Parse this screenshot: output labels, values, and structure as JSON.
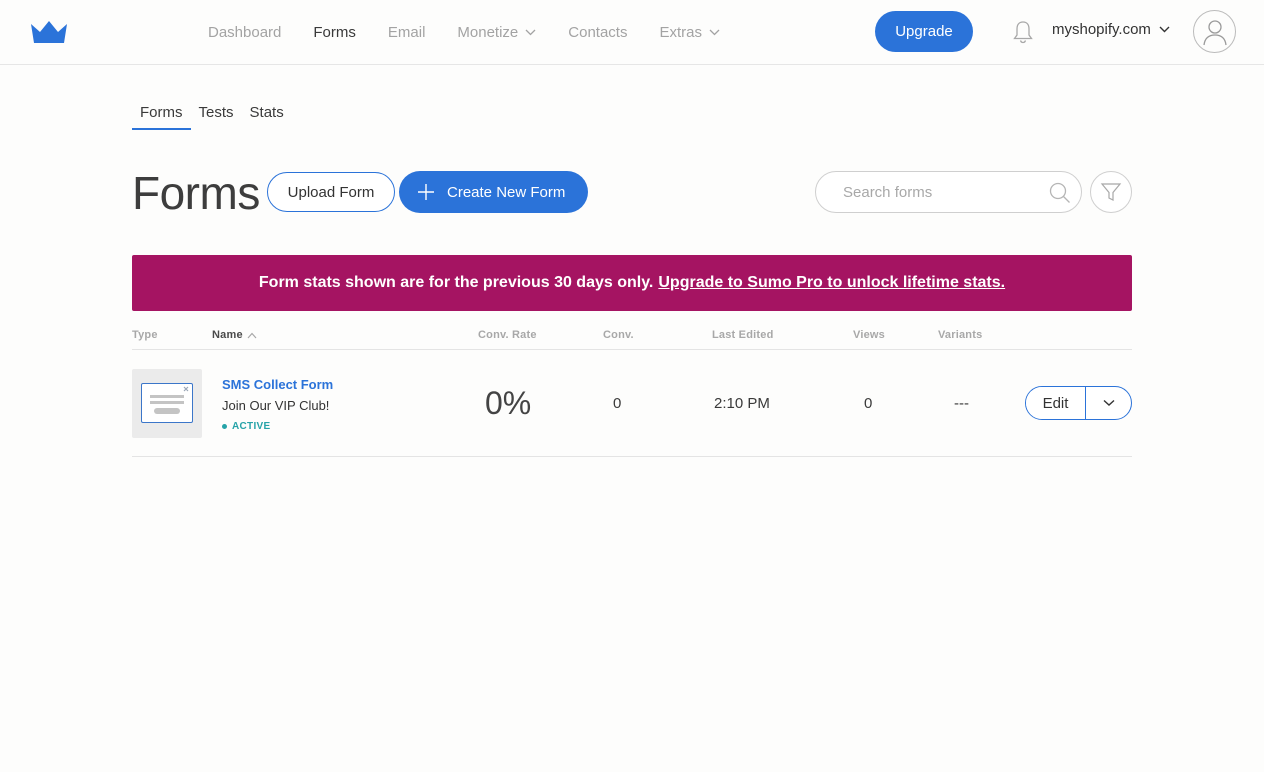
{
  "nav": {
    "items": [
      {
        "label": "Dashboard",
        "active": false,
        "dropdown": false
      },
      {
        "label": "Forms",
        "active": true,
        "dropdown": false
      },
      {
        "label": "Email",
        "active": false,
        "dropdown": false
      },
      {
        "label": "Monetize",
        "active": false,
        "dropdown": true
      },
      {
        "label": "Contacts",
        "active": false,
        "dropdown": false
      },
      {
        "label": "Extras",
        "active": false,
        "dropdown": true
      }
    ],
    "upgrade_label": "Upgrade",
    "site_label": "myshopify.com"
  },
  "subtabs": [
    {
      "label": "Forms",
      "active": true
    },
    {
      "label": "Tests",
      "active": false
    },
    {
      "label": "Stats",
      "active": false
    }
  ],
  "page": {
    "title": "Forms",
    "upload_label": "Upload Form",
    "create_label": "Create New Form",
    "search_placeholder": "Search forms"
  },
  "banner": {
    "text": "Form stats shown are for the previous 30 days only.",
    "link": "Upgrade to Sumo Pro to unlock lifetime stats."
  },
  "table": {
    "headers": {
      "type": "Type",
      "name": "Name",
      "conv_rate": "Conv. Rate",
      "conv": "Conv.",
      "last_edited": "Last Edited",
      "views": "Views",
      "variants": "Variants"
    },
    "rows": [
      {
        "name": "SMS Collect Form",
        "subtitle": "Join Our VIP Club!",
        "status": "ACTIVE",
        "conv_rate": "0%",
        "conv": "0",
        "last_edited": "2:10 PM",
        "views": "0",
        "variants": "---",
        "edit_label": "Edit"
      }
    ]
  },
  "colors": {
    "accent": "#2b73d9",
    "banner": "#a51462",
    "status_active": "#26a3a8"
  }
}
